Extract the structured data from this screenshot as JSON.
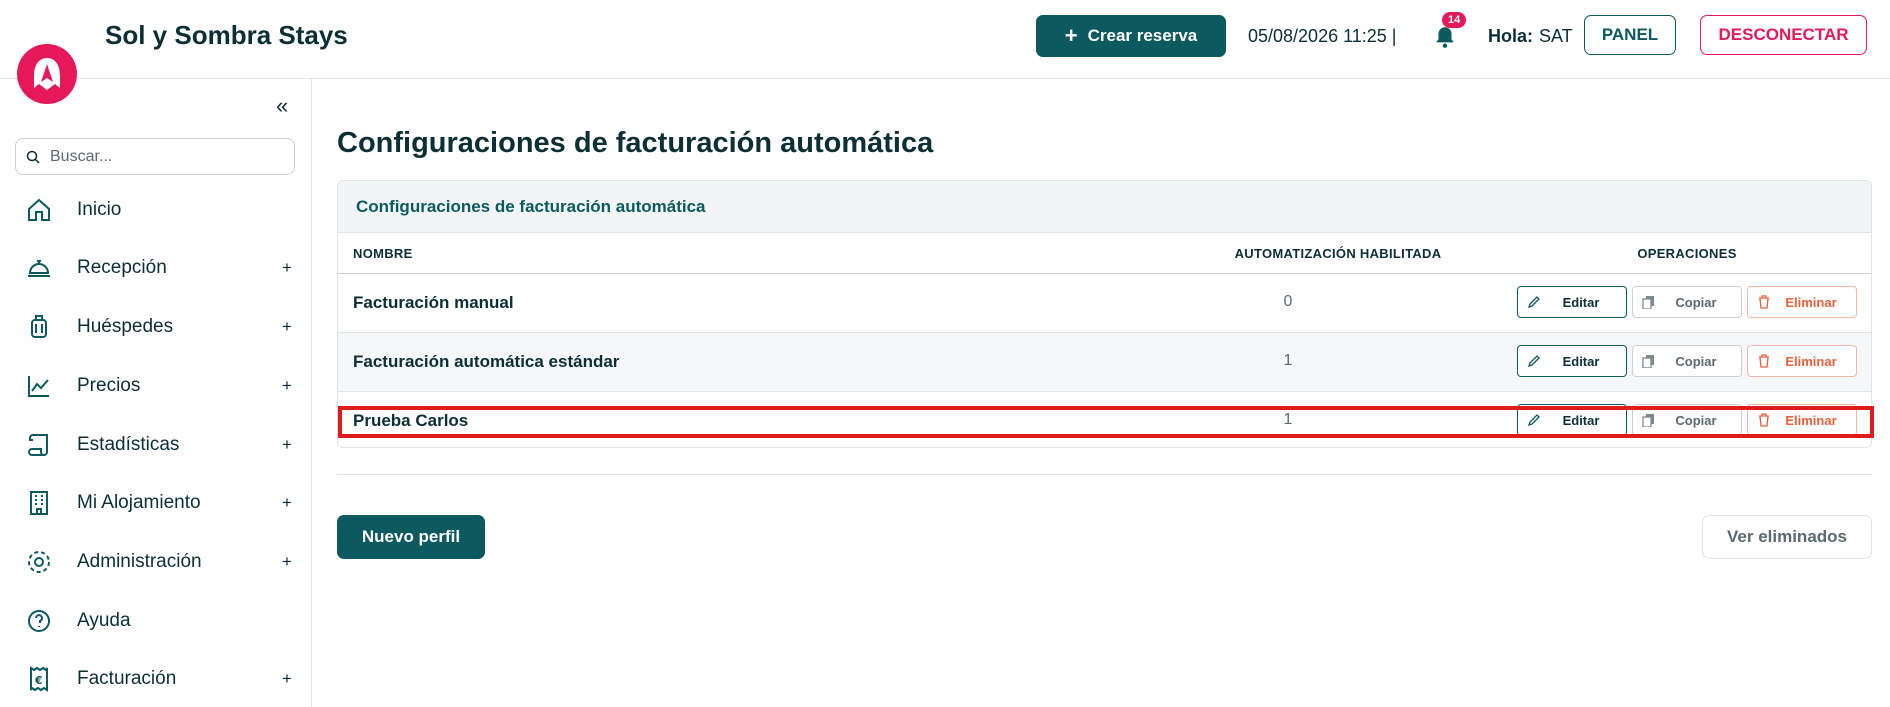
{
  "header": {
    "brand": "Sol y Sombra Stays",
    "create_label": "Crear reserva",
    "datetime": "05/08/2026 11:25 |",
    "notifications_count": "14",
    "greeting": "Hola:",
    "user": "SAT",
    "panel_label": "PANEL",
    "logout_label": "DESCONECTAR"
  },
  "sidebar": {
    "search_placeholder": "Buscar...",
    "items": [
      {
        "label": "Inicio",
        "icon": "home-icon",
        "expandable": false
      },
      {
        "label": "Recepción",
        "icon": "reception-bell-icon",
        "expandable": true
      },
      {
        "label": "Huéspedes",
        "icon": "luggage-icon",
        "expandable": true
      },
      {
        "label": "Precios",
        "icon": "chart-line-icon",
        "expandable": true
      },
      {
        "label": "Estadísticas",
        "icon": "scroll-icon",
        "expandable": true
      },
      {
        "label": "Mi Alojamiento",
        "icon": "building-icon",
        "expandable": true
      },
      {
        "label": "Administración",
        "icon": "gear-icon",
        "expandable": true
      },
      {
        "label": "Ayuda",
        "icon": "help-circle-icon",
        "expandable": false
      },
      {
        "label": "Facturación",
        "icon": "euro-receipt-icon",
        "expandable": true
      }
    ],
    "expand_symbol": "+"
  },
  "main": {
    "title": "Configuraciones de facturación automática",
    "card_title": "Configuraciones de facturación automática",
    "columns": [
      "NOMBRE",
      "AUTOMATIZACIÓN HABILITADA",
      "OPERACIONES"
    ],
    "rows": [
      {
        "name": "Facturación manual",
        "enabled": "0"
      },
      {
        "name": "Facturación automática estándar",
        "enabled": "1"
      },
      {
        "name": "Prueba Carlos",
        "enabled": "1"
      }
    ],
    "ops": {
      "edit": "Editar",
      "copy": "Copiar",
      "delete": "Eliminar"
    },
    "new_profile": "Nuevo perfil",
    "view_deleted": "Ver eliminados"
  },
  "colors": {
    "brand_teal": "#0c5a5f",
    "accent_pink": "#e5195a",
    "highlight_red": "#e01b1b"
  }
}
